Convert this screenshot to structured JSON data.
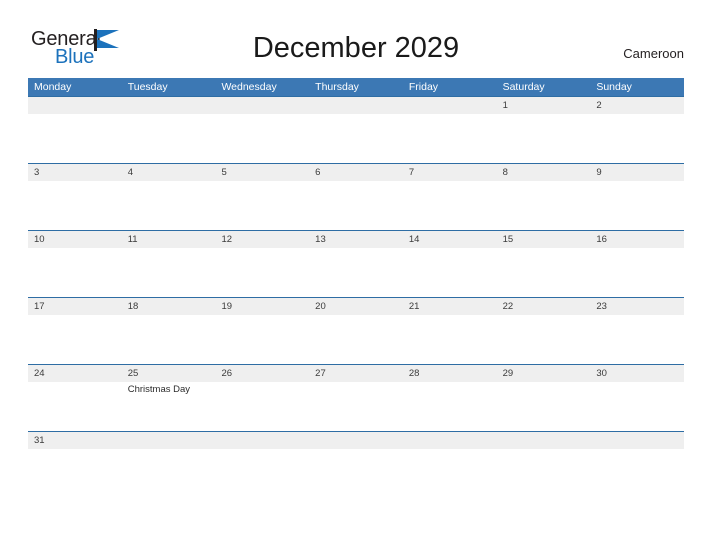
{
  "brand": {
    "name_part1": "General",
    "name_part2": "Blue",
    "flag_icon": "flag-triangle-icon",
    "color_dark": "#231f20",
    "color_blue": "#1c72bc"
  },
  "header": {
    "title": "December 2029",
    "month": "December",
    "year": "2029",
    "locale": "Cameroon"
  },
  "theme": {
    "header_blue": "#3c78b4",
    "separator_blue": "#2e6da4",
    "day_band_gray": "#efefef",
    "text_dark": "#231f20"
  },
  "calendar": {
    "weekdays": [
      "Monday",
      "Tuesday",
      "Wednesday",
      "Thursday",
      "Friday",
      "Saturday",
      "Sunday"
    ],
    "weeks": [
      {
        "days": [
          {
            "date": "",
            "event": ""
          },
          {
            "date": "",
            "event": ""
          },
          {
            "date": "",
            "event": ""
          },
          {
            "date": "",
            "event": ""
          },
          {
            "date": "",
            "event": ""
          },
          {
            "date": "1",
            "event": ""
          },
          {
            "date": "2",
            "event": ""
          }
        ]
      },
      {
        "days": [
          {
            "date": "3",
            "event": ""
          },
          {
            "date": "4",
            "event": ""
          },
          {
            "date": "5",
            "event": ""
          },
          {
            "date": "6",
            "event": ""
          },
          {
            "date": "7",
            "event": ""
          },
          {
            "date": "8",
            "event": ""
          },
          {
            "date": "9",
            "event": ""
          }
        ]
      },
      {
        "days": [
          {
            "date": "10",
            "event": ""
          },
          {
            "date": "11",
            "event": ""
          },
          {
            "date": "12",
            "event": ""
          },
          {
            "date": "13",
            "event": ""
          },
          {
            "date": "14",
            "event": ""
          },
          {
            "date": "15",
            "event": ""
          },
          {
            "date": "16",
            "event": ""
          }
        ]
      },
      {
        "days": [
          {
            "date": "17",
            "event": ""
          },
          {
            "date": "18",
            "event": ""
          },
          {
            "date": "19",
            "event": ""
          },
          {
            "date": "20",
            "event": ""
          },
          {
            "date": "21",
            "event": ""
          },
          {
            "date": "22",
            "event": ""
          },
          {
            "date": "23",
            "event": ""
          }
        ]
      },
      {
        "days": [
          {
            "date": "24",
            "event": ""
          },
          {
            "date": "25",
            "event": "Christmas Day"
          },
          {
            "date": "26",
            "event": ""
          },
          {
            "date": "27",
            "event": ""
          },
          {
            "date": "28",
            "event": ""
          },
          {
            "date": "29",
            "event": ""
          },
          {
            "date": "30",
            "event": ""
          }
        ]
      },
      {
        "days": [
          {
            "date": "31",
            "event": ""
          },
          {
            "date": "",
            "event": ""
          },
          {
            "date": "",
            "event": ""
          },
          {
            "date": "",
            "event": ""
          },
          {
            "date": "",
            "event": ""
          },
          {
            "date": "",
            "event": ""
          },
          {
            "date": "",
            "event": ""
          }
        ]
      }
    ]
  }
}
